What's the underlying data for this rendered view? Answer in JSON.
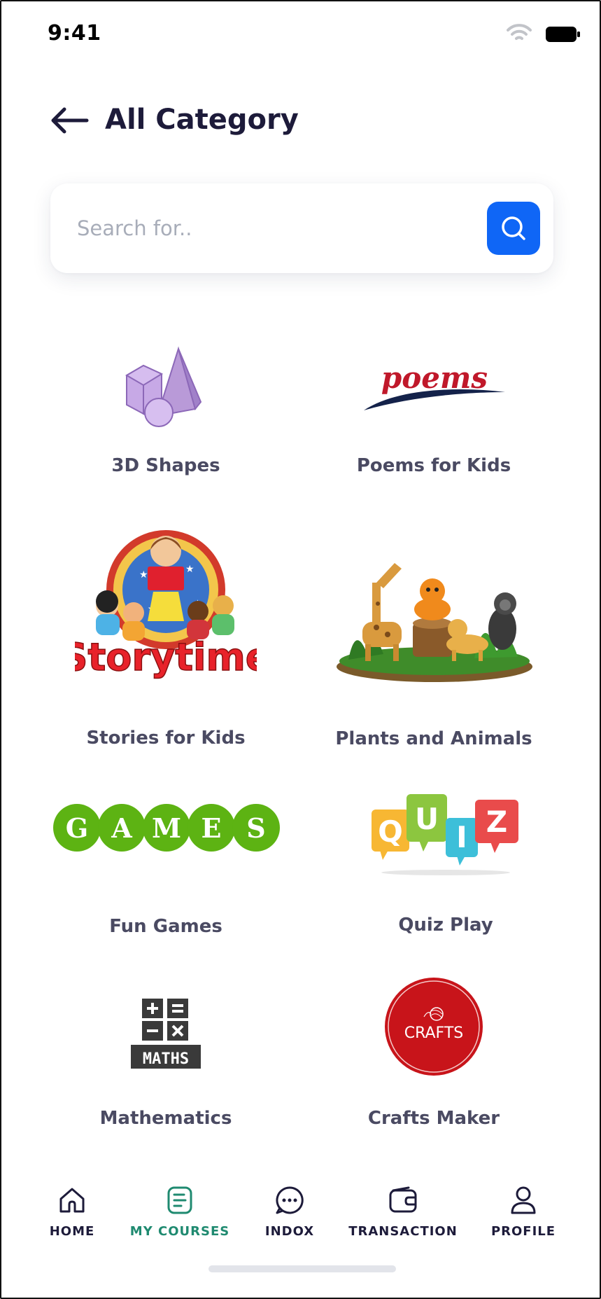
{
  "status_bar": {
    "time": "9:41"
  },
  "header": {
    "title": "All Category"
  },
  "search": {
    "placeholder": "Search for.."
  },
  "images": {
    "poems": "poems",
    "storytime": "Storytime",
    "games_letters": [
      "G",
      "A",
      "M",
      "E",
      "S"
    ],
    "quiz_letters": [
      "Q",
      "U",
      "I",
      "Z"
    ],
    "maths": "MATHS",
    "crafts": "CRAFTS"
  },
  "categories": [
    {
      "label": "3D Shapes",
      "icon": "3d-shapes-icon"
    },
    {
      "label": "Poems for Kids",
      "icon": "poems-logo"
    },
    {
      "label": "Stories for Kids",
      "icon": "storytime-logo"
    },
    {
      "label": "Plants and Animals",
      "icon": "animals-scene"
    },
    {
      "label": "Fun Games",
      "icon": "games-logo"
    },
    {
      "label": "Quiz Play",
      "icon": "quiz-logo"
    },
    {
      "label": "Mathematics",
      "icon": "maths-logo"
    },
    {
      "label": "Crafts Maker",
      "icon": "crafts-logo"
    }
  ],
  "nav": [
    {
      "label": "HOME",
      "icon": "home-icon",
      "active": false
    },
    {
      "label": "MY COURSES",
      "icon": "courses-icon",
      "active": true
    },
    {
      "label": "INDOX",
      "icon": "chat-icon",
      "active": false
    },
    {
      "label": "TRANSACTION",
      "icon": "wallet-icon",
      "active": false
    },
    {
      "label": "PROFILE",
      "icon": "profile-icon",
      "active": false
    }
  ],
  "colors": {
    "accent": "#0f66f6",
    "active_nav": "#1f8a70",
    "title": "#1d1b3a",
    "label": "#4a4a62"
  }
}
